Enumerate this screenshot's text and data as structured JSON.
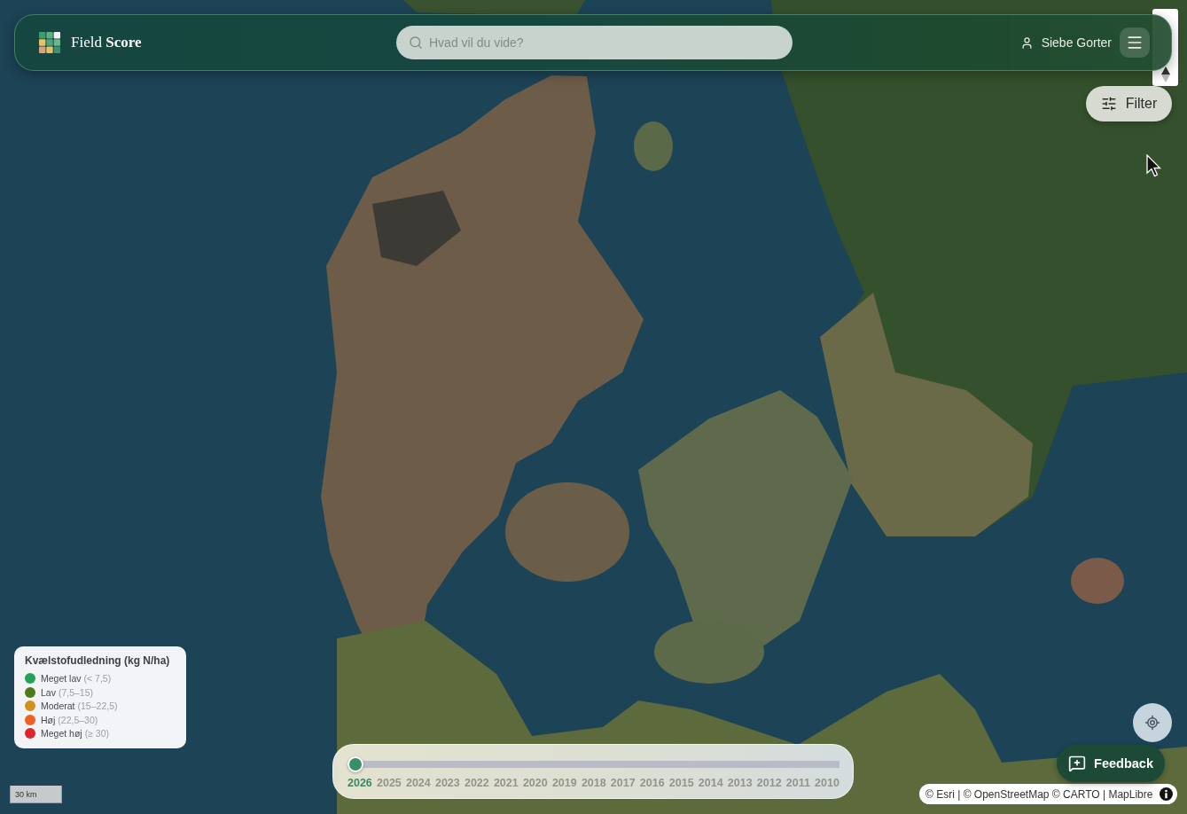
{
  "header": {
    "brand": "Field **Score**",
    "search": {
      "placeholder": "Hvad vil du vide?"
    },
    "user": {
      "name": "Siebe Gorter"
    }
  },
  "filter_button": {
    "label": "Filter"
  },
  "legend": {
    "title": "Kvælstofudledning (kg N/ha)",
    "items": [
      {
        "label": "Meget lav",
        "range": "(< 7,5)",
        "color": "#22a35a"
      },
      {
        "label": "Lav",
        "range": "(7,5–15)",
        "color": "#4e7a1c"
      },
      {
        "label": "Moderat",
        "range": "(15–22,5)",
        "color": "#d18f1c"
      },
      {
        "label": "Høj",
        "range": "(22,5–30)",
        "color": "#ee6222"
      },
      {
        "label": "Meget høj",
        "range": "(≥ 30)",
        "color": "#e0262b"
      }
    ]
  },
  "timeline": {
    "level": 0,
    "years": [
      {
        "label": "2026",
        "selected": true
      },
      {
        "label": "2025",
        "selected": false
      },
      {
        "label": "2024",
        "selected": false
      },
      {
        "label": "2023",
        "selected": false
      },
      {
        "label": "2022",
        "selected": false
      },
      {
        "label": "2021",
        "selected": false
      },
      {
        "label": "2020",
        "selected": false
      },
      {
        "label": "2019",
        "selected": false
      },
      {
        "label": "2018",
        "selected": false
      },
      {
        "label": "2017",
        "selected": false
      },
      {
        "label": "2016",
        "selected": false
      },
      {
        "label": "2015",
        "selected": false
      },
      {
        "label": "2014",
        "selected": false
      },
      {
        "label": "2013",
        "selected": false
      },
      {
        "label": "2012",
        "selected": false
      },
      {
        "label": "2011",
        "selected": false
      },
      {
        "label": "2010",
        "selected": false
      }
    ]
  },
  "scale_bar": {
    "label": "30 km"
  },
  "feedback_button": {
    "label": "Feedback"
  },
  "attribution": {
    "text": "© Esri | © OpenStreetMap © CARTO | MapLibre"
  }
}
